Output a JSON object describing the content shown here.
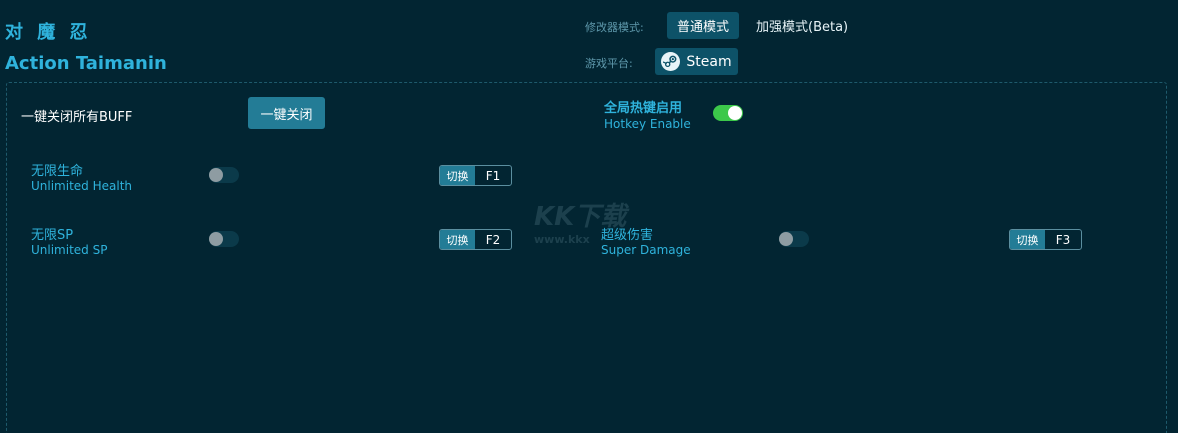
{
  "header": {
    "title_cn": "对 魔 忍",
    "title_en": "Action Taimanin"
  },
  "mode": {
    "label": "修改器模式:",
    "normal": "普通模式",
    "beta": "加强模式(Beta)"
  },
  "platform": {
    "label": "游戏平台:",
    "value": "Steam",
    "icon": "steam-icon"
  },
  "buff": {
    "label": "一键关闭所有BUFF",
    "button": "一键关闭"
  },
  "hotkey_enable": {
    "label_cn": "全局热键启用",
    "label_en": "Hotkey Enable",
    "enabled": true
  },
  "options": [
    {
      "cn": "无限生命",
      "en": "Unlimited Health",
      "enabled": false,
      "switch_label": "切换",
      "key": "F1"
    },
    {
      "cn": "无限SP",
      "en": "Unlimited SP",
      "enabled": false,
      "switch_label": "切换",
      "key": "F2"
    },
    {
      "cn": "超级伤害",
      "en": "Super Damage",
      "enabled": false,
      "switch_label": "切换",
      "key": "F3"
    }
  ],
  "watermark": {
    "logo": "KK下载",
    "url": "www.kkx"
  },
  "colors": {
    "background": "#022532",
    "accent": "#2fb3dc",
    "button": "#237c96",
    "toggle_on": "#3cc84a"
  }
}
